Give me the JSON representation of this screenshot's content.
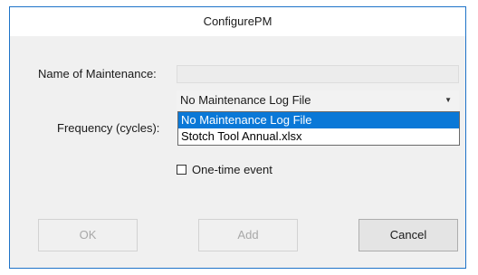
{
  "window": {
    "title": "ConfigurePM"
  },
  "form": {
    "name_label": "Name of Maintenance:",
    "name_value": "",
    "log_file_selected": "No Maintenance Log File",
    "log_file_options": [
      "No Maintenance Log File",
      "Stotch Tool Annual.xlsx"
    ],
    "log_file_highlighted_index": 0,
    "frequency_label": "Frequency (cycles):",
    "one_time_label": "One-time event",
    "one_time_checked": false
  },
  "buttons": {
    "ok": "OK",
    "add": "Add",
    "cancel": "Cancel"
  },
  "colors": {
    "accent": "#0a78d7",
    "border": "#1e73c8"
  },
  "icons": {
    "dropdown": "chevron-down-icon"
  }
}
